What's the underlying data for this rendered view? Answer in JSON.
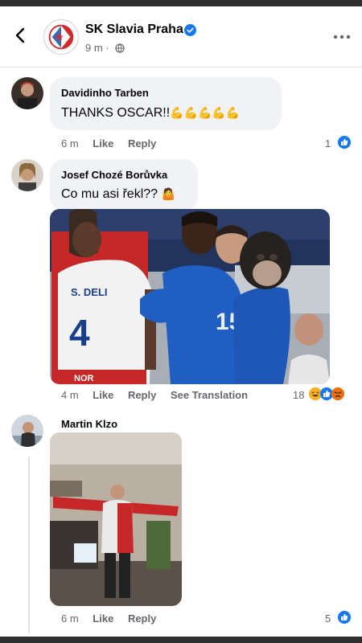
{
  "post": {
    "page_name": "SK Slavia Praha",
    "time": "9 m ·"
  },
  "comments": [
    {
      "author": "Davidinho Tarben",
      "text": "THANKS  OSCAR!!",
      "emoji": "💪💪💪💪💪",
      "time": "6 m",
      "like": "Like",
      "reply": "Reply",
      "reaction_count": "1"
    },
    {
      "author": "Josef Chozé Borůvka",
      "text": "Co mu asi řekl??",
      "emoji": "🤷",
      "time": "4 m",
      "like": "Like",
      "reply": "Reply",
      "translate": "See Translation",
      "reaction_count": "18",
      "image": {
        "shirt_text": "S. DELI",
        "shirt_number": "4",
        "blue_number": "15",
        "sponsor": "NOR"
      }
    },
    {
      "author": "Martin Klzo",
      "time": "6 m",
      "like": "Like",
      "reply": "Reply",
      "reaction_count": "5"
    }
  ],
  "colors": {
    "accent": "#1877f2",
    "bubble": "#f0f2f5",
    "muted": "#65676b",
    "slavia_red": "#d22a2a"
  },
  "icons": [
    "back-arrow-icon",
    "verified-badge-icon",
    "globe-icon",
    "more-icon",
    "like-reaction-icon",
    "haha-reaction-icon",
    "angry-reaction-icon"
  ]
}
